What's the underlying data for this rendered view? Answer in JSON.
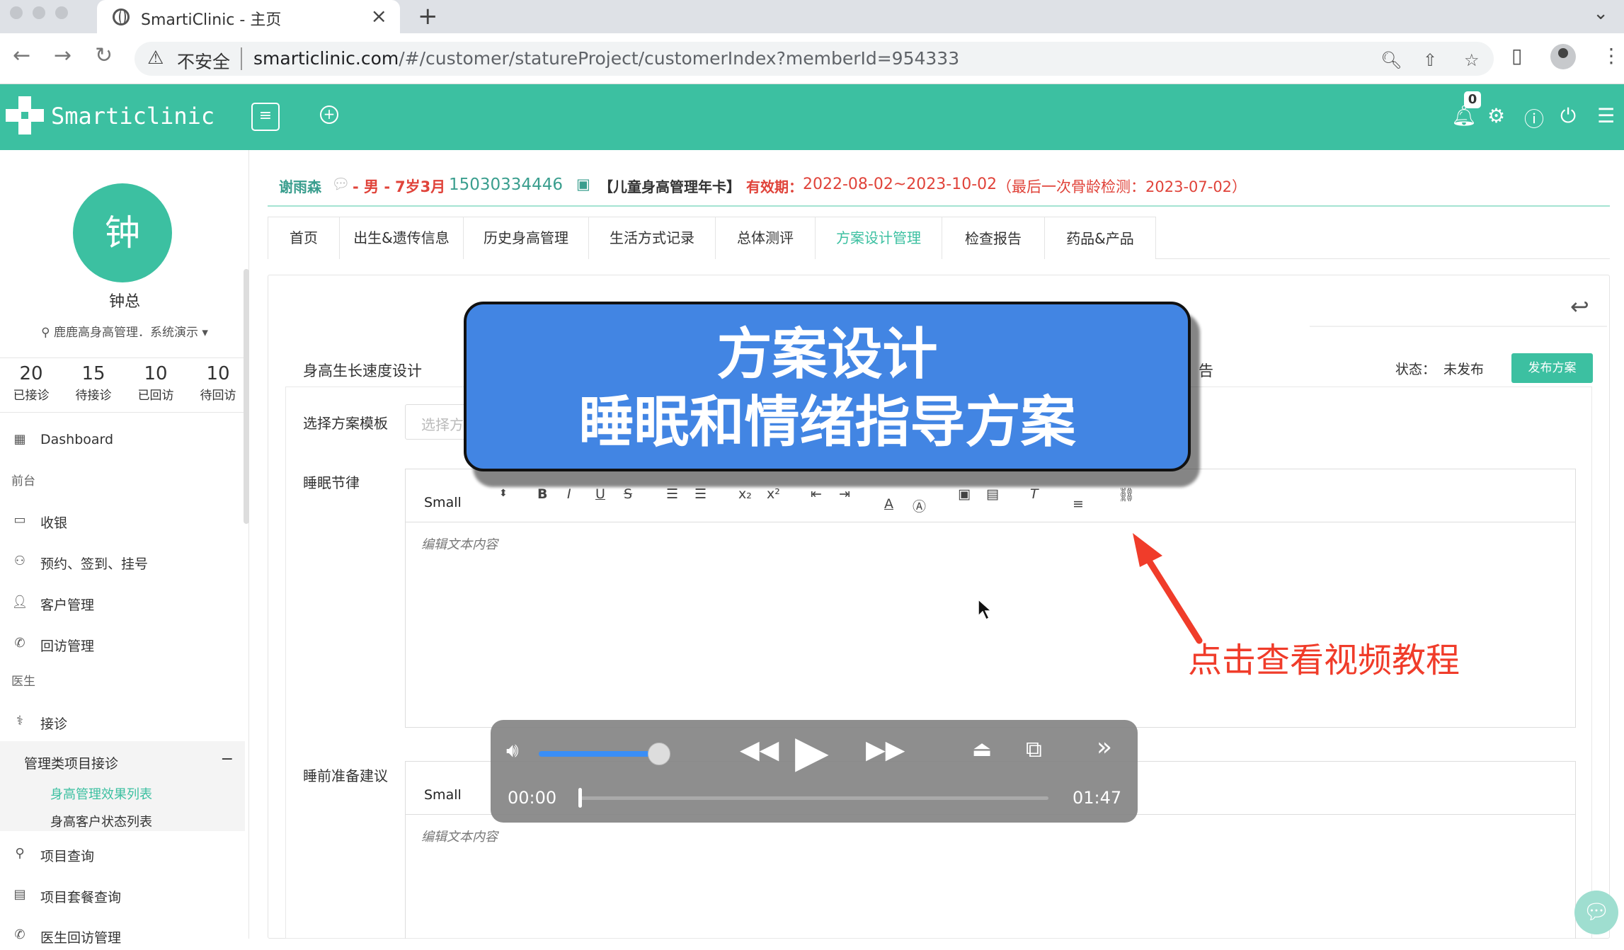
{
  "browser": {
    "tab_title": "SmartiClinic - 主页",
    "insecure_label": "不安全",
    "url_host": "smarticlinic.com",
    "url_path": "/#/customer/statureProject/customerIndex?memberId=954333"
  },
  "header": {
    "logo_text": "Smarticlinic",
    "notification_count": "0",
    "brand_color": "#3cc0a1"
  },
  "sidebar": {
    "avatar_char": "钟",
    "user_name": "钟总",
    "org": "鹿鹿高身高管理．系统演示",
    "stats": [
      {
        "value": "20",
        "label": "已接诊"
      },
      {
        "value": "15",
        "label": "待接诊"
      },
      {
        "value": "10",
        "label": "已回访"
      },
      {
        "value": "10",
        "label": "待回访"
      }
    ],
    "menu": {
      "dashboard": "Dashboard",
      "section_front": "前台",
      "cashier": "收银",
      "appointment": "预约、签到、挂号",
      "customer_mgmt": "客户管理",
      "followup_mgmt": "回访管理",
      "section_doctor": "医生",
      "reception": "接诊",
      "project_reception": "管理类项目接诊",
      "collapse_symbol": "−",
      "effect_list": "身高管理效果列表",
      "status_list": "身高客户状态列表",
      "project_query": "项目查询",
      "package_query": "项目套餐查询",
      "doctor_followup": "医生回访管理"
    }
  },
  "patient": {
    "name": "谢雨森",
    "gender": "- 男 -",
    "age": "7岁3月",
    "phone": "15030334446",
    "card": "【儿童身高管理年卡】",
    "validity_label": "有效期：",
    "validity": "2022-08-02~2023-10-02",
    "last_check": "（最后一次骨龄检测：2023-07-02）"
  },
  "tabs": [
    "首页",
    "出生&遗传信息",
    "历史身高管理",
    "生活方式记录",
    "总体测评",
    "方案设计管理",
    "检查报告",
    "药品&产品"
  ],
  "plan": {
    "section_title": "身高生长速度设计",
    "right_tab_fragment": "告",
    "status_label": "状态：",
    "status_value": "未发布",
    "publish_button": "发布方案",
    "template_label": "选择方案模板",
    "template_placeholder": "选择方",
    "sleep_label": "睡眠节律",
    "presleep_label": "睡前准备建议",
    "font_size": "Small",
    "editor_placeholder": "编辑文本内容"
  },
  "overlay": {
    "banner_line1": "方案设计",
    "banner_line2": "睡眠和情绪指导方案",
    "hint": "点击查看视频教程",
    "hint_color": "#f03c2a",
    "banner_color": "#4285e3"
  },
  "player": {
    "current_time": "00:00",
    "total_time": "01:47",
    "volume": 0.85,
    "progress": 0.0
  }
}
